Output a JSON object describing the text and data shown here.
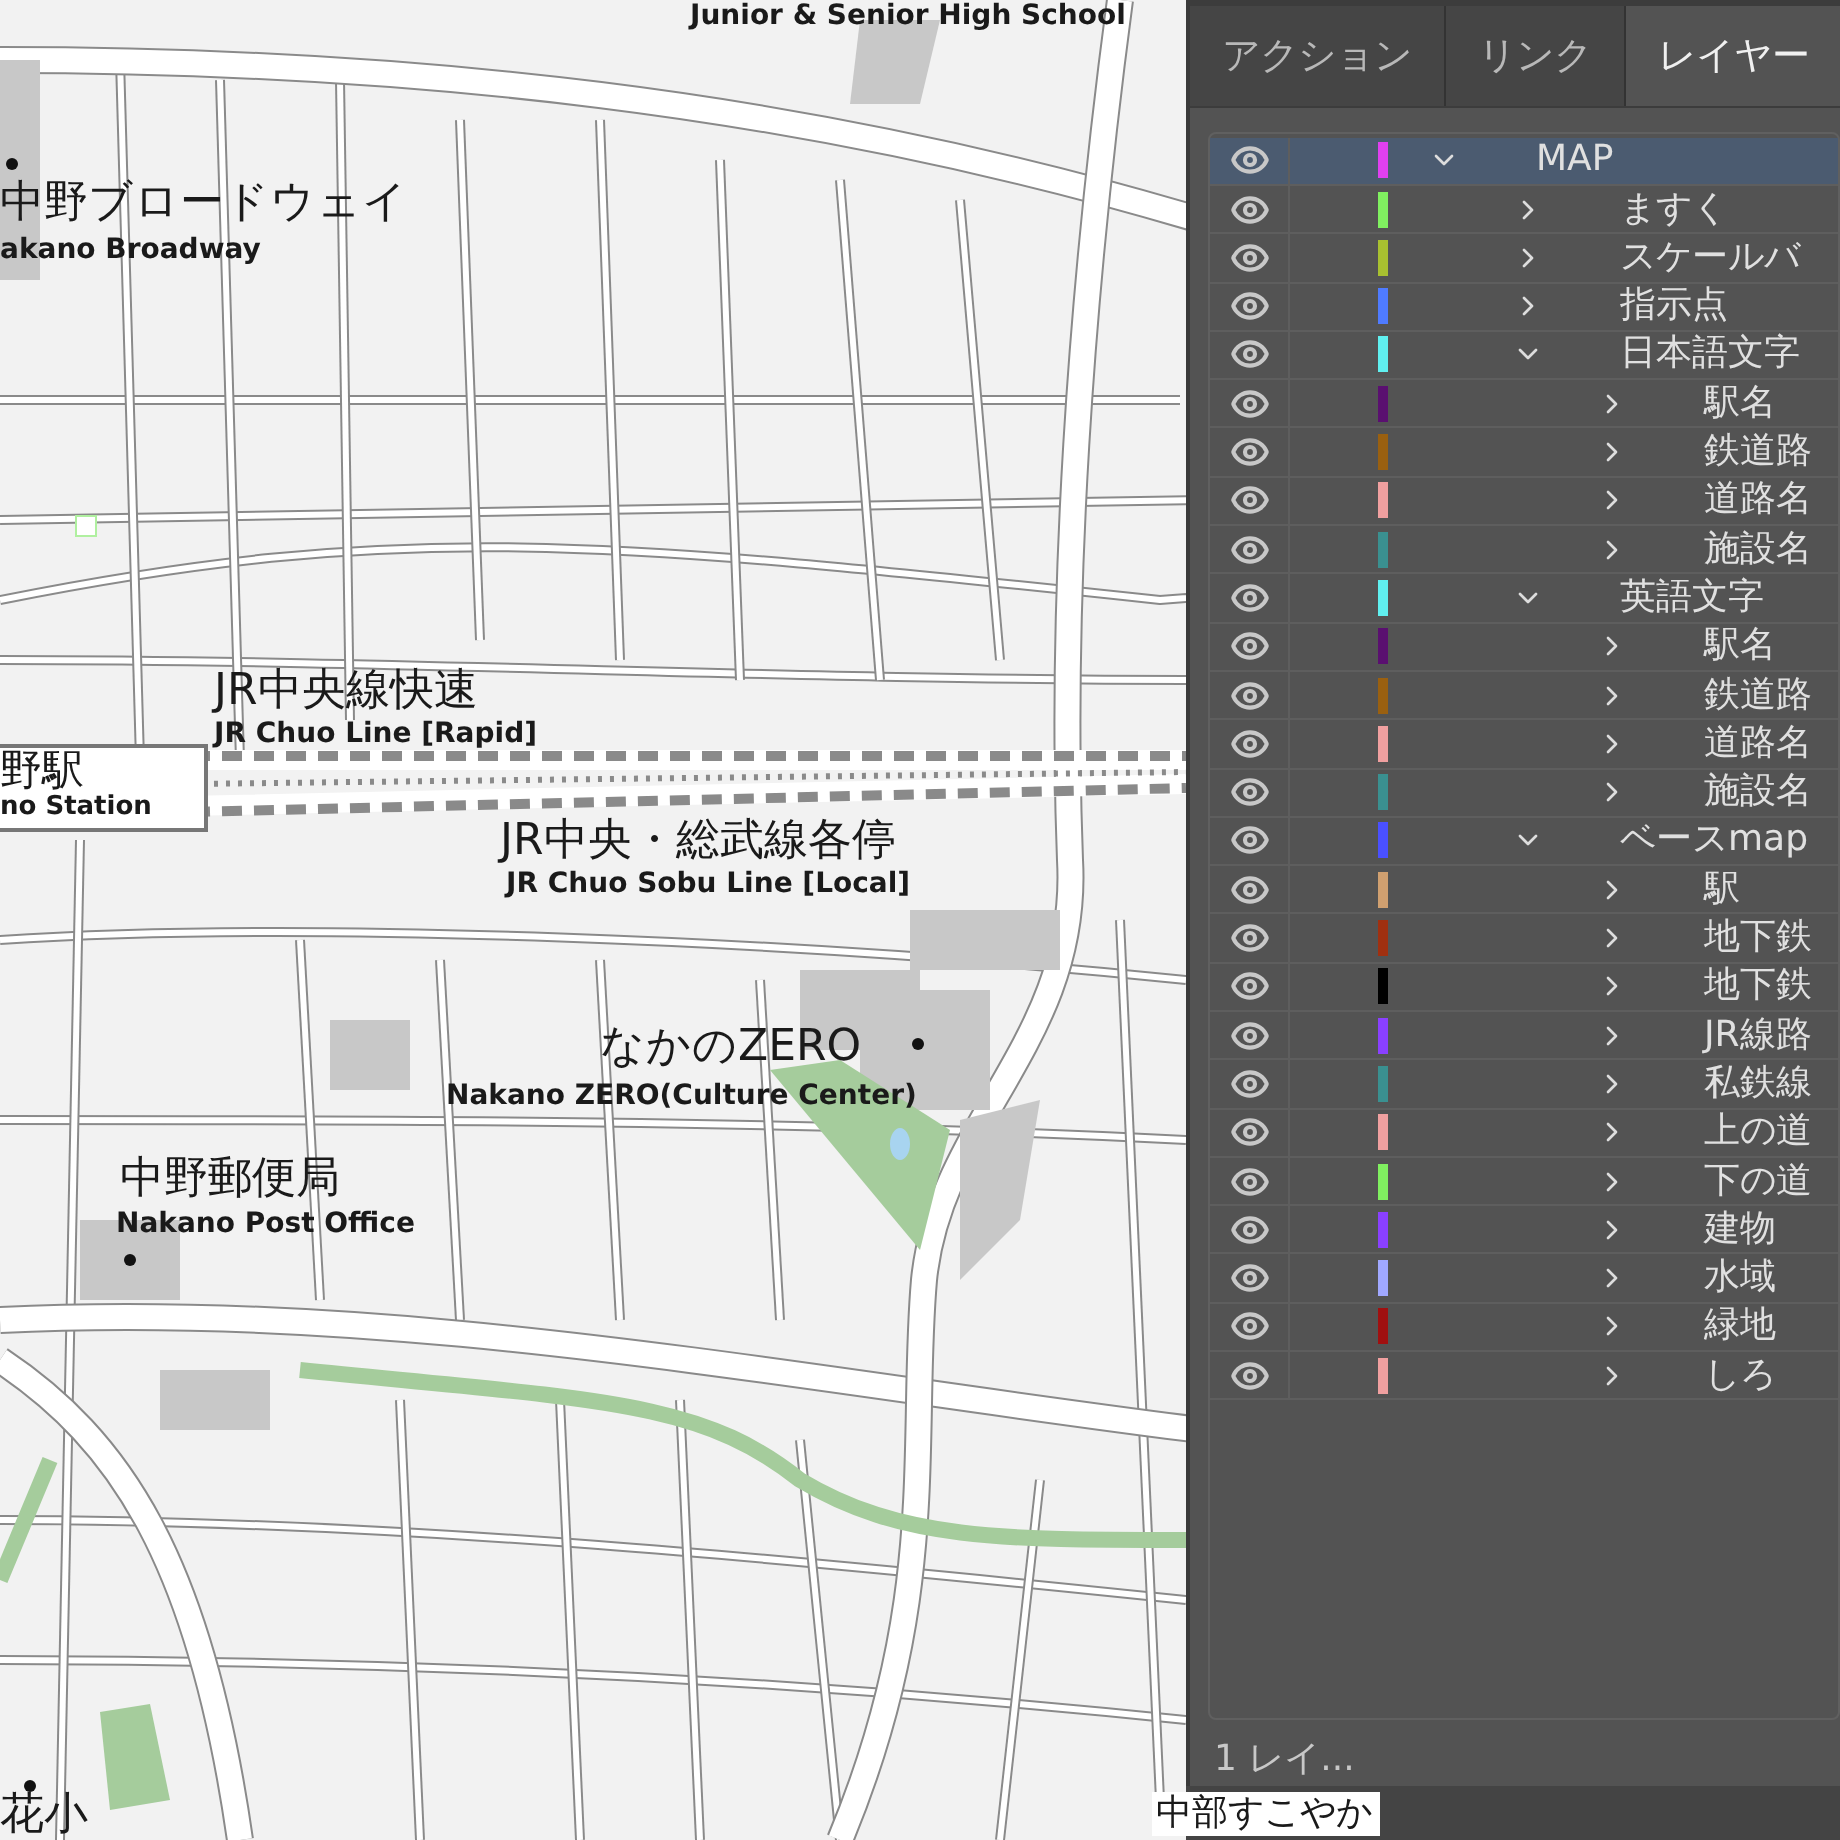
{
  "map": {
    "labels": [
      {
        "kind": "en",
        "text": "Junior & Senior High School"
      },
      {
        "kind": "ja",
        "text": "中野ブロードウェイ"
      },
      {
        "kind": "en",
        "text": "akano Broadway"
      },
      {
        "kind": "ja",
        "text": "JR中央線快速"
      },
      {
        "kind": "en",
        "text": "JR Chuo Line [Rapid]"
      },
      {
        "kind": "ja",
        "text": "JR中央・総武線各停"
      },
      {
        "kind": "en",
        "text": "JR Chuo Sobu Line [Local]"
      },
      {
        "kind": "ja",
        "text": "なかのZERO"
      },
      {
        "kind": "en",
        "text": "Nakano ZERO(Culture Center)"
      },
      {
        "kind": "ja",
        "text": "中野郵便局"
      },
      {
        "kind": "en",
        "text": "Nakano Post Office"
      },
      {
        "kind": "ja",
        "text": "花小"
      }
    ],
    "station": {
      "name_ja": "野駅",
      "name_en": "no Station"
    },
    "bottom_label": "中部すこやか"
  },
  "panel": {
    "tabs": [
      {
        "label": "アクション",
        "selected": false
      },
      {
        "label": "リンク",
        "selected": false
      },
      {
        "label": "レイヤー",
        "selected": true
      }
    ],
    "layers": [
      {
        "name": "MAP",
        "color": "#e040f0",
        "visible": true,
        "expanded": true,
        "selected": true,
        "children": [
          {
            "name": "ますく",
            "color": "#80f060",
            "visible": true,
            "expanded": false,
            "selected": false
          },
          {
            "name": "スケールバ",
            "color": "#a8c030",
            "visible": true,
            "expanded": false,
            "selected": false
          },
          {
            "name": "指示点",
            "color": "#4f7bff",
            "visible": true,
            "expanded": false,
            "selected": false
          },
          {
            "name": "日本語文字",
            "color": "#60f0f0",
            "visible": true,
            "expanded": true,
            "selected": false,
            "children": [
              {
                "name": "駅名",
                "color": "#5a1070",
                "visible": true,
                "expanded": false,
                "selected": false
              },
              {
                "name": "鉄道路",
                "color": "#9a6010",
                "visible": true,
                "expanded": false,
                "selected": false
              },
              {
                "name": "道路名",
                "color": "#f0a0a0",
                "visible": true,
                "expanded": false,
                "selected": false
              },
              {
                "name": "施設名",
                "color": "#3a9090",
                "visible": true,
                "expanded": false,
                "selected": false
              }
            ]
          },
          {
            "name": "英語文字",
            "color": "#60f0f0",
            "visible": true,
            "expanded": true,
            "selected": false,
            "children": [
              {
                "name": "駅名",
                "color": "#5a1070",
                "visible": true,
                "expanded": false,
                "selected": false
              },
              {
                "name": "鉄道路",
                "color": "#9a6010",
                "visible": true,
                "expanded": false,
                "selected": false
              },
              {
                "name": "道路名",
                "color": "#f0a0a0",
                "visible": true,
                "expanded": false,
                "selected": false
              },
              {
                "name": "施設名",
                "color": "#3a9090",
                "visible": true,
                "expanded": false,
                "selected": false
              }
            ]
          },
          {
            "name": "ベースmap",
            "color": "#4a50ff",
            "visible": true,
            "expanded": true,
            "selected": false,
            "children": [
              {
                "name": "駅",
                "color": "#d0a070",
                "visible": true,
                "expanded": false,
                "selected": false
              },
              {
                "name": "地下鉄",
                "color": "#a03010",
                "visible": true,
                "expanded": false,
                "selected": false
              },
              {
                "name": "地下鉄",
                "color": "#000000",
                "visible": true,
                "expanded": false,
                "selected": false
              },
              {
                "name": "JR線路",
                "color": "#8a40ff",
                "visible": true,
                "expanded": false,
                "selected": false
              },
              {
                "name": "私鉄線",
                "color": "#3a9090",
                "visible": true,
                "expanded": false,
                "selected": false
              },
              {
                "name": "上の道",
                "color": "#f0a0a0",
                "visible": true,
                "expanded": false,
                "selected": false
              },
              {
                "name": "下の道",
                "color": "#80f060",
                "visible": true,
                "expanded": false,
                "selected": false
              },
              {
                "name": "建物",
                "color": "#8a40ff",
                "visible": true,
                "expanded": false,
                "selected": false
              },
              {
                "name": "水域",
                "color": "#a0a8ff",
                "visible": true,
                "expanded": false,
                "selected": false
              },
              {
                "name": "緑地",
                "color": "#a01010",
                "visible": true,
                "expanded": false,
                "selected": false
              },
              {
                "name": "しろ",
                "color": "#f0a0a0",
                "visible": true,
                "expanded": false,
                "selected": false
              }
            ]
          }
        ]
      }
    ],
    "status": "1 レイ..."
  }
}
